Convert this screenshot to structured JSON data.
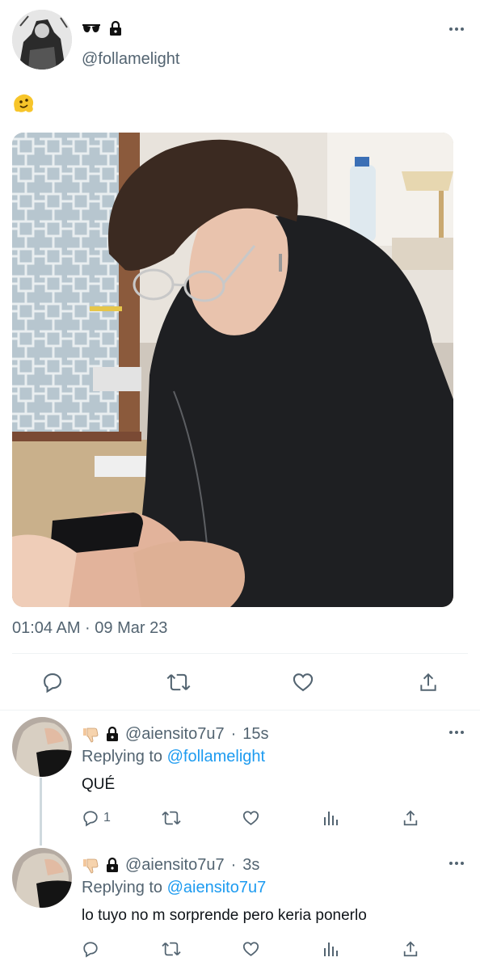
{
  "main_tweet": {
    "name_emojis": "🕶 🔒",
    "handle": "@follamelight",
    "text": "🫠",
    "timestamp": "01:04 AM · 09 Mar 23"
  },
  "replies": [
    {
      "name_emojis": "👎 🔒",
      "handle": "@aiensito7u7",
      "dot": "·",
      "time": "15s",
      "replying_prefix": "Replying to",
      "replying_to": "@follamelight",
      "text": "QUÉ",
      "reply_count": "1"
    },
    {
      "name_emojis": "👎 🔒",
      "handle": "@aiensito7u7",
      "dot": "·",
      "time": "3s",
      "replying_prefix": "Replying to",
      "replying_to": "@aiensito7u7",
      "text": "lo tuyo no m sorprende pero keria ponerlo",
      "reply_count": ""
    }
  ],
  "colors": {
    "accent": "#1d9bf0",
    "secondary_text": "#536471",
    "divider": "#eff3f4"
  },
  "icons": [
    "reply-icon",
    "retweet-icon",
    "like-icon",
    "share-icon",
    "analytics-icon",
    "more-icon",
    "lock-icon",
    "sunglasses-emoji",
    "thumbs-down-emoji"
  ]
}
